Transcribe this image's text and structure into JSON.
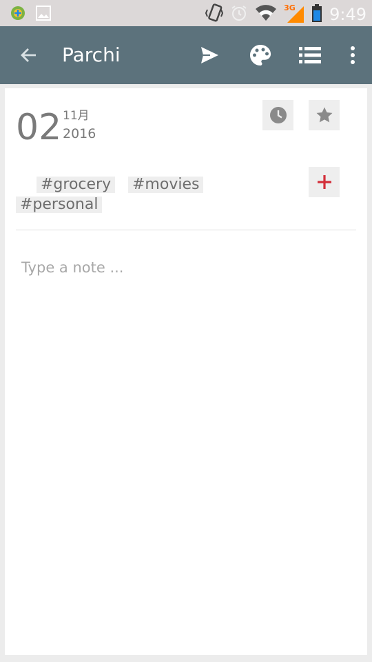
{
  "status_bar": {
    "time": "9:49",
    "network_label": "3G",
    "icons": [
      "app-notification-icon",
      "image-notification-icon",
      "vibrate-icon",
      "alarm-icon",
      "wifi-icon",
      "signal-3g-icon",
      "battery-icon"
    ]
  },
  "app_bar": {
    "title": "Parchi",
    "color": "#5c727c",
    "actions": [
      "back-arrow-icon",
      "send-icon",
      "palette-icon",
      "list-icon",
      "more-vert-icon"
    ]
  },
  "note": {
    "day": "02",
    "month": "11月",
    "year": "2016",
    "tags": [
      "#grocery",
      "#movies",
      "#personal"
    ],
    "placeholder": "Type a note ...",
    "add_tag_color": "#d32f3a"
  }
}
